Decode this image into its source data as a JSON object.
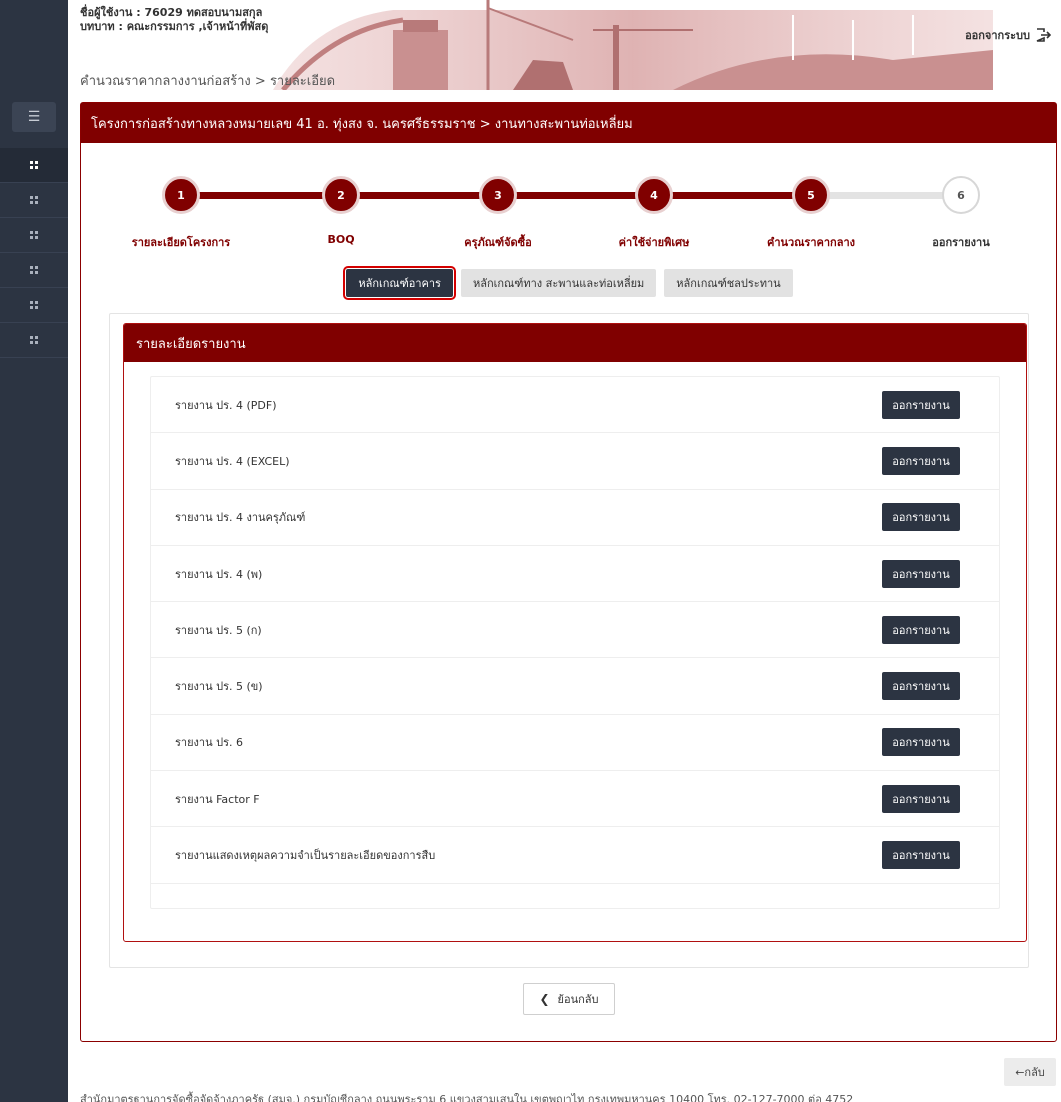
{
  "header": {
    "user_line": "ชื่อผู้ใช้งาน : 76029 ทดสอบนามสกุล",
    "role_line": "บทบาท : คณะกรรมการ ,เจ้าหน้าที่พัสดุ",
    "logout_label": "ออกจากระบบ",
    "breadcrumb": "คำนวณราคากลางงานก่อสร้าง > รายละเอียด"
  },
  "sidebar": {
    "toggle_icon": "hamburger-icon",
    "items": [
      {
        "icon": "grid-icon",
        "active": true
      },
      {
        "icon": "grid-icon",
        "active": false
      },
      {
        "icon": "grid-icon",
        "active": false
      },
      {
        "icon": "grid-icon",
        "active": false
      },
      {
        "icon": "grid-icon",
        "active": false
      },
      {
        "icon": "grid-icon",
        "active": false
      }
    ]
  },
  "project": {
    "title": "โครงการก่อสร้างทางหลวงหมายเลข 41 อ. ทุ่งสง จ. นครศรีธรรมราช > งานทางสะพานท่อเหลี่ยม"
  },
  "stepper": {
    "steps": [
      {
        "num": "1",
        "label": "รายละเอียดโครงการ",
        "done": true
      },
      {
        "num": "2",
        "label": "BOQ",
        "done": true
      },
      {
        "num": "3",
        "label": "ครุภัณฑ์จัดซื้อ",
        "done": true
      },
      {
        "num": "4",
        "label": "ค่าใช้จ่ายพิเศษ",
        "done": true
      },
      {
        "num": "5",
        "label": "คำนวณราคากลาง",
        "done": true
      },
      {
        "num": "6",
        "label": "ออกรายงาน",
        "done": false
      }
    ]
  },
  "criteria_tabs": [
    {
      "label": "หลักเกณฑ์อาคาร",
      "active": true
    },
    {
      "label": "หลักเกณฑ์ทาง สะพานและท่อเหลี่ยม",
      "active": false
    },
    {
      "label": "หลักเกณฑ์ชลประทาน",
      "active": false
    }
  ],
  "report_panel": {
    "title": "รายละเอียดรายงาน",
    "button_label": "ออกรายงาน",
    "rows": [
      "รายงาน ปร. 4 (PDF)",
      "รายงาน ปร. 4 (EXCEL)",
      "รายงาน ปร. 4 งานครุภัณฑ์",
      "รายงาน ปร. 4 (พ)",
      "รายงาน ปร. 5 (ก)",
      "รายงาน ปร. 5 (ข)",
      "รายงาน ปร. 6",
      "รายงาน Factor F",
      "รายงานแสดงเหตุผลความจำเป็นรายละเอียดของการสืบ"
    ]
  },
  "back_button": {
    "label": "ย้อนกลับ",
    "icon": "chevron-left-icon"
  },
  "footer": {
    "back_label": "←กลับ",
    "text": "สำนักมาตรฐานการจัดซื้อจัดจ้างภาครัฐ (สมจ.) กรมบัญชีกลาง ถนนพระราม 6 แขวงสามเสนใน เขตพญาไท กรุงเทพมหานคร 10400 โทร. 02-127-7000 ต่อ 4752"
  },
  "colors": {
    "primary": "#800000",
    "sidebar": "#2c3442",
    "button_dark": "#2c3442",
    "active_outline": "#d40000"
  }
}
